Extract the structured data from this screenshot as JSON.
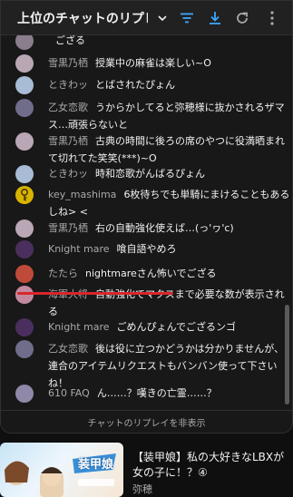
{
  "header": {
    "title": "上位のチャットのリプレ",
    "accent": "#3ea6ff"
  },
  "messages": [
    {
      "author": "",
      "text": "ござる"
    },
    {
      "author": "雪黒乃栖",
      "text": "授業中の麻雀は楽しい~O"
    },
    {
      "author": "ときわッ",
      "text": "とばされたぴょん"
    },
    {
      "author": "乙女恋歌",
      "text": "うからかしてると弥穂様に抜かされるザマス…頑張らないと"
    },
    {
      "author": "雪黒乃栖",
      "text": "古典の時間に後ろの席のやつに役満晒まれて切れてた笑笑(***)~O"
    },
    {
      "author": "ときわッ",
      "text": "時和恋歌がんばるぴょん"
    },
    {
      "author": "key_mashima",
      "text": "6枚待ちでも単騎にまけることもあるしね> <"
    },
    {
      "author": "雪黒乃栖",
      "text": "右の自動強化使えば…(っ'ヮ'c)"
    },
    {
      "author": "Knight mare",
      "text": "喰自語やめろ"
    },
    {
      "author": "たたら",
      "text": "nightmareさん怖いでござる"
    },
    {
      "author": "海軍大将",
      "text": "自動強化でマクスまで必要な数が表示される"
    },
    {
      "author": "Knight mare",
      "text": "ごめんぴょんでござるンゴ"
    },
    {
      "author": "乙女恋歌",
      "text": "後は役に立つかどうかは分かりませんが、連合のアイテムリクエストもバンバン使って下さいね！"
    },
    {
      "author": "610 FAQ",
      "text": "ん……？嘆きの亡霊……？"
    }
  ],
  "hide_replay_label": "チャットのリプレイを非表示",
  "recommendation": {
    "title": "【装甲娘】私の大好きなLBXが女の子に！？④",
    "channel": "弥穂",
    "thumb_logo": "装甲娘"
  },
  "colors": {
    "highlight_underline": "#d8262a"
  }
}
